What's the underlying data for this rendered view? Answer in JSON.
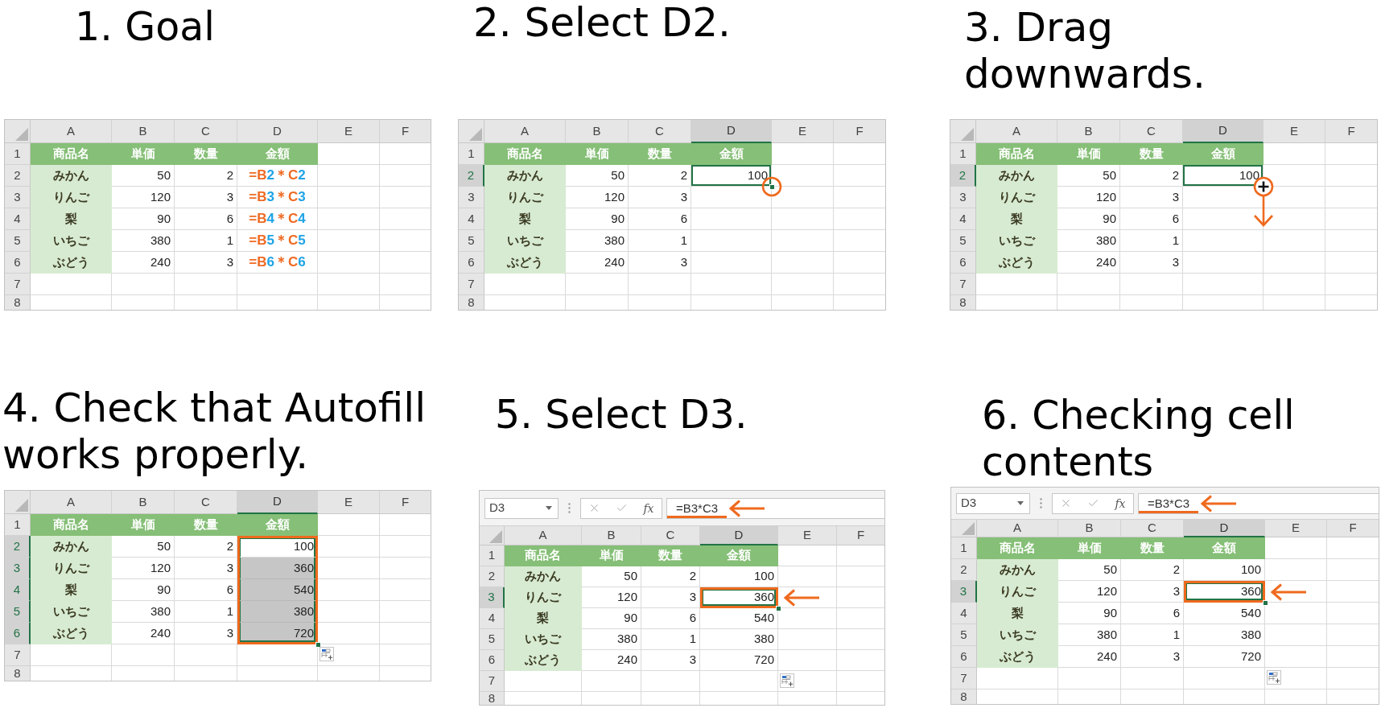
{
  "steps": [
    {
      "title": "1. Goal",
      "sheet": {
        "columns": [
          {
            "label": "A",
            "selected": false
          },
          {
            "label": "B",
            "selected": false
          },
          {
            "label": "C",
            "selected": false
          },
          {
            "label": "D",
            "selected": false
          },
          {
            "label": "E",
            "selected": false
          },
          {
            "label": "F",
            "selected": false
          }
        ],
        "rows": [
          {
            "label": "1",
            "selected": false,
            "cells": [
              {
                "kind": "header",
                "text": "商品名",
                "selected": false
              },
              {
                "kind": "header",
                "text": "単価",
                "selected": false
              },
              {
                "kind": "header",
                "text": "数量",
                "selected": false
              },
              {
                "kind": "header",
                "text": "金額",
                "selected": false
              }
            ]
          },
          {
            "label": "2",
            "selected": false,
            "cells": [
              {
                "kind": "name",
                "text": "みかん",
                "selected": false
              },
              {
                "kind": "number",
                "text": "50",
                "selected": false
              },
              {
                "kind": "number",
                "text": "2",
                "selected": false
              },
              {
                "kind": "formula",
                "parts": [
                  {
                    "text": "=B",
                    "color": "#ef6b24"
                  },
                  {
                    "text": "2",
                    "color": "#1ea3e6"
                  },
                  {
                    "text": "＊C",
                    "color": "#ef6b24"
                  },
                  {
                    "text": "2",
                    "color": "#1ea3e6"
                  }
                ],
                "selected": false
              }
            ]
          },
          {
            "label": "3",
            "selected": false,
            "cells": [
              {
                "kind": "name",
                "text": "りんご",
                "selected": false
              },
              {
                "kind": "number",
                "text": "120",
                "selected": false
              },
              {
                "kind": "number",
                "text": "3",
                "selected": false
              },
              {
                "kind": "formula",
                "parts": [
                  {
                    "text": "=B",
                    "color": "#ef6b24"
                  },
                  {
                    "text": "3",
                    "color": "#1ea3e6"
                  },
                  {
                    "text": "＊C",
                    "color": "#ef6b24"
                  },
                  {
                    "text": "3",
                    "color": "#1ea3e6"
                  }
                ],
                "selected": false
              }
            ]
          },
          {
            "label": "4",
            "selected": false,
            "cells": [
              {
                "kind": "name",
                "text": "梨",
                "selected": false
              },
              {
                "kind": "number",
                "text": "90",
                "selected": false
              },
              {
                "kind": "number",
                "text": "6",
                "selected": false
              },
              {
                "kind": "formula",
                "parts": [
                  {
                    "text": "=B",
                    "color": "#ef6b24"
                  },
                  {
                    "text": "4",
                    "color": "#1ea3e6"
                  },
                  {
                    "text": "＊C",
                    "color": "#ef6b24"
                  },
                  {
                    "text": "4",
                    "color": "#1ea3e6"
                  }
                ],
                "selected": false
              }
            ]
          },
          {
            "label": "5",
            "selected": false,
            "cells": [
              {
                "kind": "name",
                "text": "いちご",
                "selected": false
              },
              {
                "kind": "number",
                "text": "380",
                "selected": false
              },
              {
                "kind": "number",
                "text": "1",
                "selected": false
              },
              {
                "kind": "formula",
                "parts": [
                  {
                    "text": "=B",
                    "color": "#ef6b24"
                  },
                  {
                    "text": "5",
                    "color": "#1ea3e6"
                  },
                  {
                    "text": "＊C",
                    "color": "#ef6b24"
                  },
                  {
                    "text": "5",
                    "color": "#1ea3e6"
                  }
                ],
                "selected": false
              }
            ]
          },
          {
            "label": "6",
            "selected": false,
            "cells": [
              {
                "kind": "name",
                "text": "ぶどう",
                "selected": false
              },
              {
                "kind": "number",
                "text": "240",
                "selected": false
              },
              {
                "kind": "number",
                "text": "3",
                "selected": false
              },
              {
                "kind": "formula",
                "parts": [
                  {
                    "text": "=B",
                    "color": "#ef6b24"
                  },
                  {
                    "text": "6",
                    "color": "#1ea3e6"
                  },
                  {
                    "text": "＊C",
                    "color": "#ef6b24"
                  },
                  {
                    "text": "6",
                    "color": "#1ea3e6"
                  }
                ],
                "selected": false
              }
            ]
          },
          {
            "label": "7",
            "selected": false
          },
          {
            "label": "8",
            "selected": false
          }
        ]
      }
    },
    {
      "title": "2. Select D2.",
      "sheet": {
        "callout": {
          "kind": "circle"
        },
        "columns": [
          {
            "label": "A",
            "selected": false
          },
          {
            "label": "B",
            "selected": false
          },
          {
            "label": "C",
            "selected": false
          },
          {
            "label": "D",
            "selected": true
          },
          {
            "label": "E",
            "selected": false
          },
          {
            "label": "F",
            "selected": false
          }
        ],
        "rows": [
          {
            "label": "1",
            "selected": false,
            "cells": [
              {
                "kind": "header",
                "text": "商品名",
                "selected": false
              },
              {
                "kind": "header",
                "text": "単価",
                "selected": false
              },
              {
                "kind": "header",
                "text": "数量",
                "selected": false
              },
              {
                "kind": "header",
                "text": "金額",
                "selected": false
              }
            ]
          },
          {
            "label": "2",
            "selected": true,
            "cells": [
              {
                "kind": "name",
                "text": "みかん",
                "selected": false
              },
              {
                "kind": "number",
                "text": "50",
                "selected": false
              },
              {
                "kind": "number",
                "text": "2",
                "selected": false
              },
              {
                "kind": "number",
                "text": "100",
                "selected": true
              }
            ]
          },
          {
            "label": "3",
            "selected": false,
            "cells": [
              {
                "kind": "name",
                "text": "りんご",
                "selected": false
              },
              {
                "kind": "number",
                "text": "120",
                "selected": false
              },
              {
                "kind": "number",
                "text": "3",
                "selected": false
              }
            ]
          },
          {
            "label": "4",
            "selected": false,
            "cells": [
              {
                "kind": "name",
                "text": "梨",
                "selected": false
              },
              {
                "kind": "number",
                "text": "90",
                "selected": false
              },
              {
                "kind": "number",
                "text": "6",
                "selected": false
              }
            ]
          },
          {
            "label": "5",
            "selected": false,
            "cells": [
              {
                "kind": "name",
                "text": "いちご",
                "selected": false
              },
              {
                "kind": "number",
                "text": "380",
                "selected": false
              },
              {
                "kind": "number",
                "text": "1",
                "selected": false
              }
            ]
          },
          {
            "label": "6",
            "selected": false,
            "cells": [
              {
                "kind": "name",
                "text": "ぶどう",
                "selected": false
              },
              {
                "kind": "number",
                "text": "240",
                "selected": false
              },
              {
                "kind": "number",
                "text": "3",
                "selected": false
              }
            ]
          },
          {
            "label": "7",
            "selected": false
          },
          {
            "label": "8",
            "selected": false
          }
        ]
      }
    },
    {
      "title": "3. Drag downwards.",
      "sheet": {
        "callout": {
          "kind": "drag"
        },
        "columns": [
          {
            "label": "A",
            "selected": false
          },
          {
            "label": "B",
            "selected": false
          },
          {
            "label": "C",
            "selected": false
          },
          {
            "label": "D",
            "selected": true
          },
          {
            "label": "E",
            "selected": false
          },
          {
            "label": "F",
            "selected": false
          }
        ],
        "rows": [
          {
            "label": "1",
            "selected": false,
            "cells": [
              {
                "kind": "header",
                "text": "商品名",
                "selected": false
              },
              {
                "kind": "header",
                "text": "単価",
                "selected": false
              },
              {
                "kind": "header",
                "text": "数量",
                "selected": false
              },
              {
                "kind": "header",
                "text": "金額",
                "selected": false
              }
            ]
          },
          {
            "label": "2",
            "selected": true,
            "cells": [
              {
                "kind": "name",
                "text": "みかん",
                "selected": false
              },
              {
                "kind": "number",
                "text": "50",
                "selected": false
              },
              {
                "kind": "number",
                "text": "2",
                "selected": false
              },
              {
                "kind": "number",
                "text": "100",
                "selected": true
              }
            ]
          },
          {
            "label": "3",
            "selected": false,
            "cells": [
              {
                "kind": "name",
                "text": "りんご",
                "selected": false
              },
              {
                "kind": "number",
                "text": "120",
                "selected": false
              },
              {
                "kind": "number",
                "text": "3",
                "selected": false
              }
            ]
          },
          {
            "label": "4",
            "selected": false,
            "cells": [
              {
                "kind": "name",
                "text": "梨",
                "selected": false
              },
              {
                "kind": "number",
                "text": "90",
                "selected": false
              },
              {
                "kind": "number",
                "text": "6",
                "selected": false
              }
            ]
          },
          {
            "label": "5",
            "selected": false,
            "cells": [
              {
                "kind": "name",
                "text": "いちご",
                "selected": false
              },
              {
                "kind": "number",
                "text": "380",
                "selected": false
              },
              {
                "kind": "number",
                "text": "1",
                "selected": false
              }
            ]
          },
          {
            "label": "6",
            "selected": false,
            "cells": [
              {
                "kind": "name",
                "text": "ぶどう",
                "selected": false
              },
              {
                "kind": "number",
                "text": "240",
                "selected": false
              },
              {
                "kind": "number",
                "text": "3",
                "selected": false
              }
            ]
          },
          {
            "label": "7",
            "selected": false
          },
          {
            "label": "8",
            "selected": false
          }
        ]
      }
    },
    {
      "title": "4. Check that Autofill works properly.",
      "sheet": {
        "selection_highlighted": true,
        "autofill_options": true,
        "columns": [
          {
            "label": "A",
            "selected": false
          },
          {
            "label": "B",
            "selected": false
          },
          {
            "label": "C",
            "selected": false
          },
          {
            "label": "D",
            "selected": true
          },
          {
            "label": "E",
            "selected": false
          },
          {
            "label": "F",
            "selected": false
          }
        ],
        "rows": [
          {
            "label": "1",
            "selected": false,
            "cells": [
              {
                "kind": "header",
                "text": "商品名",
                "selected": false
              },
              {
                "kind": "header",
                "text": "単価",
                "selected": false
              },
              {
                "kind": "header",
                "text": "数量",
                "selected": false
              },
              {
                "kind": "header",
                "text": "金額",
                "selected": false
              }
            ]
          },
          {
            "label": "2",
            "selected": true,
            "cells": [
              {
                "kind": "name",
                "text": "みかん",
                "selected": false
              },
              {
                "kind": "number",
                "text": "50",
                "selected": false
              },
              {
                "kind": "number",
                "text": "2",
                "selected": false
              },
              {
                "kind": "number",
                "text": "100",
                "selected": true
              }
            ]
          },
          {
            "label": "3",
            "selected": true,
            "cells": [
              {
                "kind": "name",
                "text": "りんご",
                "selected": false
              },
              {
                "kind": "number",
                "text": "120",
                "selected": false
              },
              {
                "kind": "number",
                "text": "3",
                "selected": false
              },
              {
                "kind": "number",
                "text": "360",
                "selected": true
              }
            ]
          },
          {
            "label": "4",
            "selected": true,
            "cells": [
              {
                "kind": "name",
                "text": "梨",
                "selected": false
              },
              {
                "kind": "number",
                "text": "90",
                "selected": false
              },
              {
                "kind": "number",
                "text": "6",
                "selected": false
              },
              {
                "kind": "number",
                "text": "540",
                "selected": true
              }
            ]
          },
          {
            "label": "5",
            "selected": true,
            "cells": [
              {
                "kind": "name",
                "text": "いちご",
                "selected": false
              },
              {
                "kind": "number",
                "text": "380",
                "selected": false
              },
              {
                "kind": "number",
                "text": "1",
                "selected": false
              },
              {
                "kind": "number",
                "text": "380",
                "selected": true
              }
            ]
          },
          {
            "label": "6",
            "selected": true,
            "cells": [
              {
                "kind": "name",
                "text": "ぶどう",
                "selected": false
              },
              {
                "kind": "number",
                "text": "240",
                "selected": false
              },
              {
                "kind": "number",
                "text": "3",
                "selected": false
              },
              {
                "kind": "number",
                "text": "720",
                "selected": true
              }
            ]
          },
          {
            "label": "7",
            "selected": false
          },
          {
            "label": "8",
            "selected": false
          }
        ]
      }
    },
    {
      "title": "5. Select D3.",
      "sheet": {
        "formula_bar": {
          "name_box": "D3",
          "function_label": "fx",
          "formula": "=B3*C3",
          "highlighted": true
        },
        "callout": {
          "kind": "arrow"
        },
        "selection_highlighted": true,
        "autofill_options": true,
        "columns": [
          {
            "label": "A",
            "selected": false
          },
          {
            "label": "B",
            "selected": false
          },
          {
            "label": "C",
            "selected": false
          },
          {
            "label": "D",
            "selected": true
          },
          {
            "label": "E",
            "selected": false
          },
          {
            "label": "F",
            "selected": false
          }
        ],
        "rows": [
          {
            "label": "1",
            "selected": false,
            "cells": [
              {
                "kind": "header",
                "text": "商品名",
                "selected": false
              },
              {
                "kind": "header",
                "text": "単価",
                "selected": false
              },
              {
                "kind": "header",
                "text": "数量",
                "selected": false
              },
              {
                "kind": "header",
                "text": "金額",
                "selected": false
              }
            ]
          },
          {
            "label": "2",
            "selected": false,
            "cells": [
              {
                "kind": "name",
                "text": "みかん",
                "selected": false
              },
              {
                "kind": "number",
                "text": "50",
                "selected": false
              },
              {
                "kind": "number",
                "text": "2",
                "selected": false
              },
              {
                "kind": "number",
                "text": "100",
                "selected": false
              }
            ]
          },
          {
            "label": "3",
            "selected": true,
            "cells": [
              {
                "kind": "name",
                "text": "りんご",
                "selected": false
              },
              {
                "kind": "number",
                "text": "120",
                "selected": false
              },
              {
                "kind": "number",
                "text": "3",
                "selected": false
              },
              {
                "kind": "number",
                "text": "360",
                "selected": true
              }
            ]
          },
          {
            "label": "4",
            "selected": false,
            "cells": [
              {
                "kind": "name",
                "text": "梨",
                "selected": false
              },
              {
                "kind": "number",
                "text": "90",
                "selected": false
              },
              {
                "kind": "number",
                "text": "6",
                "selected": false
              },
              {
                "kind": "number",
                "text": "540",
                "selected": false
              }
            ]
          },
          {
            "label": "5",
            "selected": false,
            "cells": [
              {
                "kind": "name",
                "text": "いちご",
                "selected": false
              },
              {
                "kind": "number",
                "text": "380",
                "selected": false
              },
              {
                "kind": "number",
                "text": "1",
                "selected": false
              },
              {
                "kind": "number",
                "text": "380",
                "selected": false
              }
            ]
          },
          {
            "label": "6",
            "selected": false,
            "cells": [
              {
                "kind": "name",
                "text": "ぶどう",
                "selected": false
              },
              {
                "kind": "number",
                "text": "240",
                "selected": false
              },
              {
                "kind": "number",
                "text": "3",
                "selected": false
              },
              {
                "kind": "number",
                "text": "720",
                "selected": false
              }
            ]
          },
          {
            "label": "7",
            "selected": false
          },
          {
            "label": "8",
            "selected": false
          }
        ]
      }
    },
    {
      "title": "6. Checking cell contents",
      "sheet": {
        "formula_bar": {
          "name_box": "D3",
          "function_label": "fx",
          "formula": "=B3*C3",
          "highlighted": true
        },
        "callout": {
          "kind": "arrow"
        },
        "selection_highlighted": true,
        "autofill_options": true,
        "columns": [
          {
            "label": "A",
            "selected": false
          },
          {
            "label": "B",
            "selected": false
          },
          {
            "label": "C",
            "selected": false
          },
          {
            "label": "D",
            "selected": true
          },
          {
            "label": "E",
            "selected": false
          },
          {
            "label": "F",
            "selected": false
          }
        ],
        "rows": [
          {
            "label": "1",
            "selected": false,
            "cells": [
              {
                "kind": "header",
                "text": "商品名",
                "selected": false
              },
              {
                "kind": "header",
                "text": "単価",
                "selected": false
              },
              {
                "kind": "header",
                "text": "数量",
                "selected": false
              },
              {
                "kind": "header",
                "text": "金額",
                "selected": false
              }
            ]
          },
          {
            "label": "2",
            "selected": false,
            "cells": [
              {
                "kind": "name",
                "text": "みかん",
                "selected": false
              },
              {
                "kind": "number",
                "text": "50",
                "selected": false
              },
              {
                "kind": "number",
                "text": "2",
                "selected": false
              },
              {
                "kind": "number",
                "text": "100",
                "selected": false
              }
            ]
          },
          {
            "label": "3",
            "selected": true,
            "cells": [
              {
                "kind": "name",
                "text": "りんご",
                "selected": false
              },
              {
                "kind": "number",
                "text": "120",
                "selected": false
              },
              {
                "kind": "number",
                "text": "3",
                "selected": false
              },
              {
                "kind": "number",
                "text": "360",
                "selected": true
              }
            ]
          },
          {
            "label": "4",
            "selected": false,
            "cells": [
              {
                "kind": "name",
                "text": "梨",
                "selected": false
              },
              {
                "kind": "number",
                "text": "90",
                "selected": false
              },
              {
                "kind": "number",
                "text": "6",
                "selected": false
              },
              {
                "kind": "number",
                "text": "540",
                "selected": false
              }
            ]
          },
          {
            "label": "5",
            "selected": false,
            "cells": [
              {
                "kind": "name",
                "text": "いちご",
                "selected": false
              },
              {
                "kind": "number",
                "text": "380",
                "selected": false
              },
              {
                "kind": "number",
                "text": "1",
                "selected": false
              },
              {
                "kind": "number",
                "text": "380",
                "selected": false
              }
            ]
          },
          {
            "label": "6",
            "selected": false,
            "cells": [
              {
                "kind": "name",
                "text": "ぶどう",
                "selected": false
              },
              {
                "kind": "number",
                "text": "240",
                "selected": false
              },
              {
                "kind": "number",
                "text": "3",
                "selected": false
              },
              {
                "kind": "number",
                "text": "720",
                "selected": false
              }
            ]
          },
          {
            "label": "7",
            "selected": false
          },
          {
            "label": "8",
            "selected": false
          }
        ]
      }
    }
  ]
}
